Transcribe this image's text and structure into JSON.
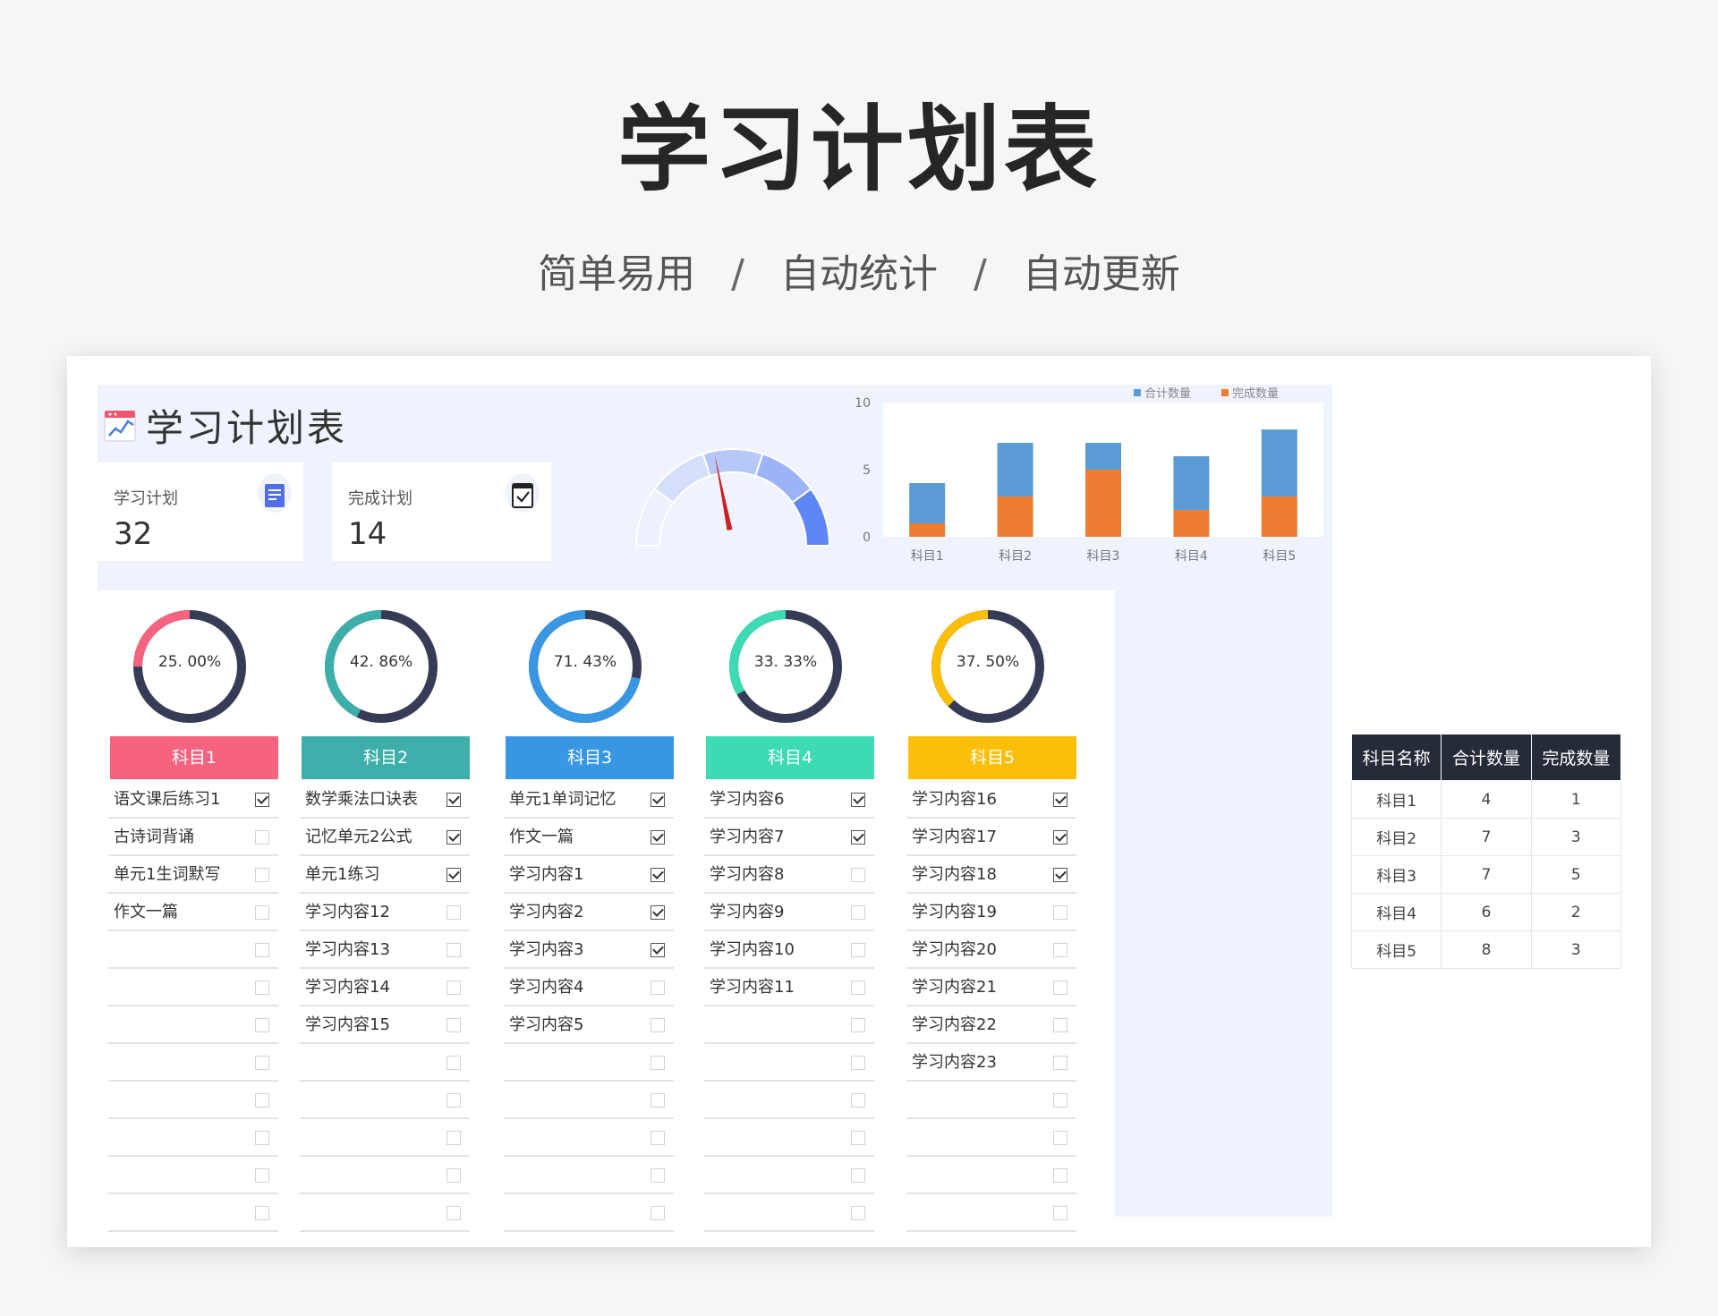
{
  "hero": {
    "title": "学习计划表",
    "features": [
      "简单易用",
      "自动统计",
      "自动更新"
    ],
    "separator": "/"
  },
  "sheet": {
    "title": "学习计划表",
    "logo_icon": "chart-notebook-icon"
  },
  "kpis": {
    "plan": {
      "label": "学习计划",
      "value": "32",
      "icon": "document-icon"
    },
    "done": {
      "label": "完成计划",
      "value": "14",
      "icon": "calendar-check-icon"
    }
  },
  "gauge": {
    "completion": 0.4375,
    "colors": [
      "#eef1fd",
      "#d5defb",
      "#b6c8fa",
      "#9db3f8",
      "#5e86f4"
    ],
    "needle_color": "#cc1f1f"
  },
  "chart_data": {
    "type": "bar",
    "stacked": true,
    "categories": [
      "科目1",
      "科目2",
      "科目3",
      "科目4",
      "科目5"
    ],
    "series": [
      {
        "name": "合计数量",
        "values": [
          4,
          7,
          7,
          6,
          8
        ],
        "color": "#5b9bd5"
      },
      {
        "name": "完成数量",
        "values": [
          1,
          3,
          5,
          2,
          3
        ],
        "color": "#ed7d31"
      }
    ],
    "yticks": [
      "0",
      "5",
      "10"
    ],
    "ylim": [
      0,
      10
    ],
    "legend": "top-right",
    "grid": false
  },
  "subjects": [
    {
      "name": "科目1",
      "percent": "25. 00%",
      "ratio": 0.25,
      "color": "#f6637f",
      "items": [
        {
          "text": "语文课后练习1",
          "checked": true
        },
        {
          "text": "古诗词背诵",
          "checked": false
        },
        {
          "text": "单元1生词默写",
          "checked": false
        },
        {
          "text": "作文一篇",
          "checked": false
        },
        {
          "text": "",
          "checked": false
        },
        {
          "text": "",
          "checked": false
        },
        {
          "text": "",
          "checked": false
        },
        {
          "text": "",
          "checked": false
        },
        {
          "text": "",
          "checked": false
        },
        {
          "text": "",
          "checked": false
        },
        {
          "text": "",
          "checked": false
        },
        {
          "text": "",
          "checked": false
        }
      ]
    },
    {
      "name": "科目2",
      "percent": "42. 86%",
      "ratio": 0.4286,
      "color": "#3eaeaa",
      "items": [
        {
          "text": "数学乘法口诀表",
          "checked": true
        },
        {
          "text": "记忆单元2公式",
          "checked": true
        },
        {
          "text": "单元1练习",
          "checked": true
        },
        {
          "text": "学习内容12",
          "checked": false
        },
        {
          "text": "学习内容13",
          "checked": false
        },
        {
          "text": "学习内容14",
          "checked": false
        },
        {
          "text": "学习内容15",
          "checked": false
        },
        {
          "text": "",
          "checked": false
        },
        {
          "text": "",
          "checked": false
        },
        {
          "text": "",
          "checked": false
        },
        {
          "text": "",
          "checked": false
        },
        {
          "text": "",
          "checked": false
        }
      ]
    },
    {
      "name": "科目3",
      "percent": "71. 43%",
      "ratio": 0.7143,
      "color": "#3896e3",
      "items": [
        {
          "text": "单元1单词记忆",
          "checked": true
        },
        {
          "text": "作文一篇",
          "checked": true
        },
        {
          "text": "学习内容1",
          "checked": true
        },
        {
          "text": "学习内容2",
          "checked": true
        },
        {
          "text": "学习内容3",
          "checked": true
        },
        {
          "text": "学习内容4",
          "checked": false
        },
        {
          "text": "学习内容5",
          "checked": false
        },
        {
          "text": "",
          "checked": false
        },
        {
          "text": "",
          "checked": false
        },
        {
          "text": "",
          "checked": false
        },
        {
          "text": "",
          "checked": false
        },
        {
          "text": "",
          "checked": false
        }
      ]
    },
    {
      "name": "科目4",
      "percent": "33. 33%",
      "ratio": 0.3333,
      "color": "#3ddbb4",
      "items": [
        {
          "text": "学习内容6",
          "checked": true
        },
        {
          "text": "学习内容7",
          "checked": true
        },
        {
          "text": "学习内容8",
          "checked": false
        },
        {
          "text": "学习内容9",
          "checked": false
        },
        {
          "text": "学习内容10",
          "checked": false
        },
        {
          "text": "学习内容11",
          "checked": false
        },
        {
          "text": "",
          "checked": false
        },
        {
          "text": "",
          "checked": false
        },
        {
          "text": "",
          "checked": false
        },
        {
          "text": "",
          "checked": false
        },
        {
          "text": "",
          "checked": false
        },
        {
          "text": "",
          "checked": false
        }
      ]
    },
    {
      "name": "科目5",
      "percent": "37. 50%",
      "ratio": 0.375,
      "color": "#fbbf0a",
      "items": [
        {
          "text": "学习内容16",
          "checked": true
        },
        {
          "text": "学习内容17",
          "checked": true
        },
        {
          "text": "学习内容18",
          "checked": true
        },
        {
          "text": "学习内容19",
          "checked": false
        },
        {
          "text": "学习内容20",
          "checked": false
        },
        {
          "text": "学习内容21",
          "checked": false
        },
        {
          "text": "学习内容22",
          "checked": false
        },
        {
          "text": "学习内容23",
          "checked": false
        },
        {
          "text": "",
          "checked": false
        },
        {
          "text": "",
          "checked": false
        },
        {
          "text": "",
          "checked": false
        },
        {
          "text": "",
          "checked": false
        }
      ]
    }
  ],
  "summary_table": {
    "headers": [
      "科目名称",
      "合计数量",
      "完成数量"
    ],
    "rows": [
      [
        "科目1",
        "4",
        "1"
      ],
      [
        "科目2",
        "7",
        "3"
      ],
      [
        "科目3",
        "7",
        "5"
      ],
      [
        "科目4",
        "6",
        "2"
      ],
      [
        "科目5",
        "8",
        "3"
      ]
    ]
  },
  "colors": {
    "donut_track": "#363c55",
    "sheet_bg": "#eff3fd",
    "table_header": "#262b38"
  }
}
